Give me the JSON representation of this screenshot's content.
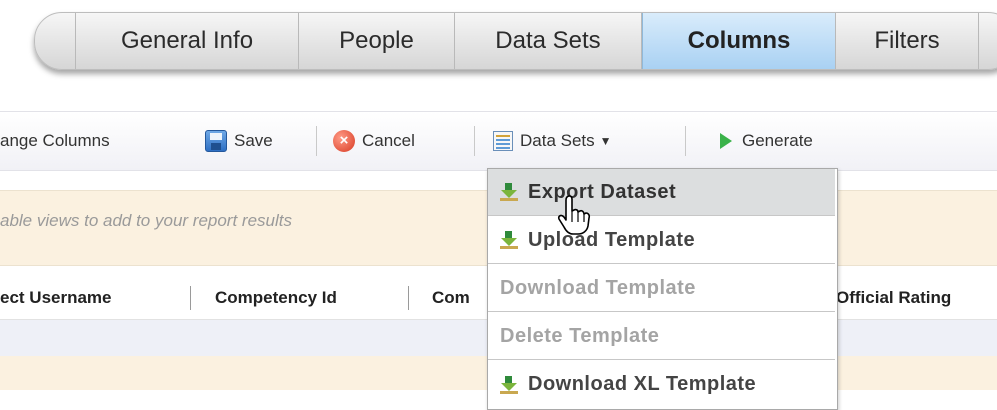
{
  "tabs": {
    "items": [
      "General Info",
      "People",
      "Data Sets",
      "Columns",
      "Filters"
    ],
    "active": "Columns"
  },
  "toolbar": {
    "arrange_label": "ange Columns",
    "save_label": "Save",
    "cancel_label": "Cancel",
    "datasets_label": "Data Sets",
    "generate_label": "Generate"
  },
  "info": {
    "text": "able views to add to your report results"
  },
  "columns": {
    "c1": "ect Username",
    "c2": "Competency Id",
    "c3": "Com",
    "c4": "Official Rating"
  },
  "menu": {
    "items": [
      {
        "label": "Export Dataset",
        "state": "hover",
        "icon": "download-icon"
      },
      {
        "label": "Upload Template",
        "state": "enabled",
        "icon": "download-icon"
      },
      {
        "label": "Download Template",
        "state": "disabled"
      },
      {
        "label": "Delete Template",
        "state": "disabled"
      },
      {
        "label": "Download XL Template",
        "state": "enabled",
        "icon": "download-icon"
      }
    ]
  },
  "colors": {
    "active_tab": "#a9d1f3",
    "info_bg": "#fbf1e0",
    "generate_green": "#3ab24a"
  }
}
